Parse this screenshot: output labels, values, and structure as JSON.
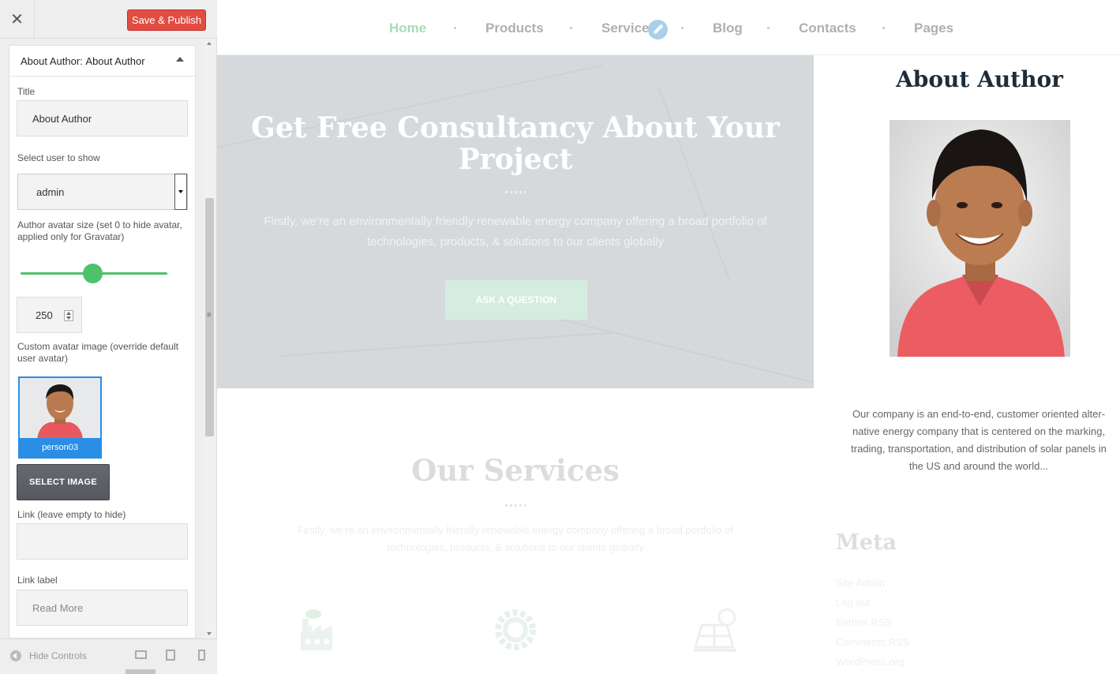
{
  "customizer": {
    "close_label": "✕",
    "publish_label": "Save & Publish",
    "section": {
      "prefix": "About Author:",
      "name": "About Author"
    },
    "fields": {
      "title_label": "Title",
      "title_value": "About Author",
      "user_label": "Select user to show",
      "user_value": "admin",
      "avatar_size_label": "Author avatar size (set 0 to hide avatar, applied only for Gravatar)",
      "avatar_size_value": "250",
      "custom_avatar_label": "Custom avatar image (override default user avatar)",
      "avatar_image_name": "person03",
      "select_image_label": "SELECT IMAGE",
      "link_label": "Link (leave empty to hide)",
      "link_value": "",
      "link_label_label": "Link label",
      "link_label_placeholder": "Read More"
    },
    "footer": {
      "hide_controls": "Hide Controls"
    }
  },
  "site": {
    "nav": [
      {
        "label": "Home",
        "active": true
      },
      {
        "label": "Products"
      },
      {
        "label": "Service"
      },
      {
        "label": "Blog"
      },
      {
        "label": "Contacts"
      },
      {
        "label": "Pages"
      }
    ],
    "hero": {
      "title": "Get Free Consultancy About Your Project",
      "text": "Firstly, we’re an environmentally friendly renewable energy company offering a broad portfolio of technologies, products, & solutions to our clients globally",
      "button": "ASK A QUESTION"
    },
    "about_widget": {
      "title": "About Author",
      "bio": "Our company is an end-to-end, customer oriented alter-native energy company that is centered on the marking, trading, transportation, and distribution of solar panels in the US and around the world..."
    },
    "services": {
      "title": "Our Services",
      "text": "Firstly, we’re an environmentally friendly renewable energy company offering a broad portfolio of technologies, products, & solutions to our clients globally",
      "icons": [
        "factory-icon",
        "gear-icon",
        "solar-panel-icon"
      ]
    },
    "meta": {
      "title": "Meta",
      "links": [
        "Site Admin",
        "Log out",
        "Entries RSS",
        "Comments RSS",
        "WordPress.org"
      ]
    }
  },
  "colors": {
    "accent_green": "#4cc36a",
    "publish_red": "#e14d43",
    "select_blue": "#2b8ee6"
  }
}
